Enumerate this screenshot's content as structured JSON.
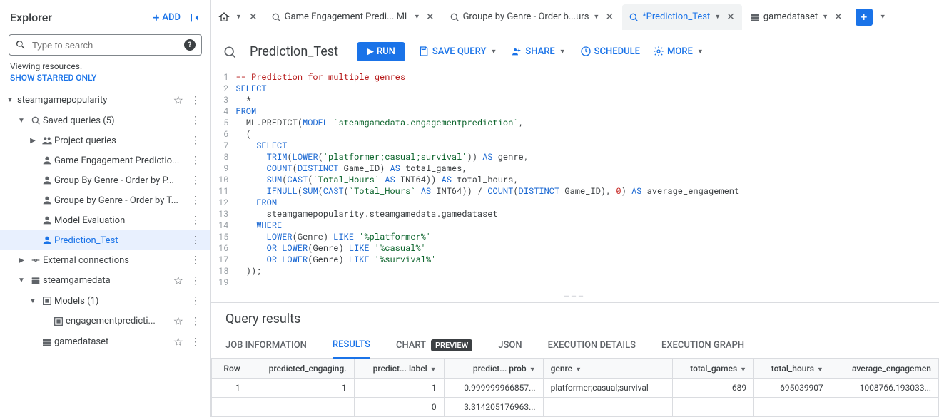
{
  "sidebar": {
    "title": "Explorer",
    "add_label": "ADD",
    "search_placeholder": "Type to search",
    "viewing_text": "Viewing resources.",
    "starred_link": "SHOW STARRED ONLY",
    "tree": {
      "project": "steamgamepopularity",
      "saved_queries_label": "Saved queries (5)",
      "project_queries_label": "Project queries",
      "queries": [
        "Game Engagement Predictio...",
        "Group By Genre - Order by P...",
        "Groupe by Genre - Order by T...",
        "Model Evaluation",
        "Prediction_Test"
      ],
      "external_label": "External connections",
      "dataset": "steamgamedata",
      "models_label": "Models (1)",
      "model_name": "engagementpredicti...",
      "table_name": "gamedataset"
    }
  },
  "tabs": [
    {
      "icon": "query",
      "label": "Game Engagement Predi...  ML",
      "active": false
    },
    {
      "icon": "query",
      "label": "Groupe by Genre - Order b...urs",
      "active": false
    },
    {
      "icon": "query",
      "label": "*Prediction_Test",
      "active": true
    },
    {
      "icon": "table",
      "label": "gamedataset",
      "active": false
    }
  ],
  "toolbar": {
    "title": "Prediction_Test",
    "run": "RUN",
    "save": "SAVE QUERY",
    "share": "SHARE",
    "schedule": "SCHEDULE",
    "more": "MORE"
  },
  "code_lines": 19,
  "results": {
    "title": "Query results",
    "tabs": [
      "JOB INFORMATION",
      "RESULTS",
      "CHART",
      "JSON",
      "EXECUTION DETAILS",
      "EXECUTION GRAPH"
    ],
    "preview_badge": "PREVIEW",
    "columns": [
      "Row",
      "predicted_engaging.",
      "predict... label",
      "predict... prob",
      "genre",
      "total_games",
      "total_hours",
      "average_engagemen"
    ],
    "rows": [
      {
        "row": "1",
        "pred_eng": "1",
        "label": "1",
        "prob": "0.999999966857...",
        "genre": "platformer;casual;survival",
        "total_games": "689",
        "total_hours": "695039907",
        "avg": "1008766.193033..."
      },
      {
        "row": "",
        "pred_eng": "",
        "label": "0",
        "prob": "3.314205176963...",
        "genre": "",
        "total_games": "",
        "total_hours": "",
        "avg": ""
      }
    ]
  }
}
